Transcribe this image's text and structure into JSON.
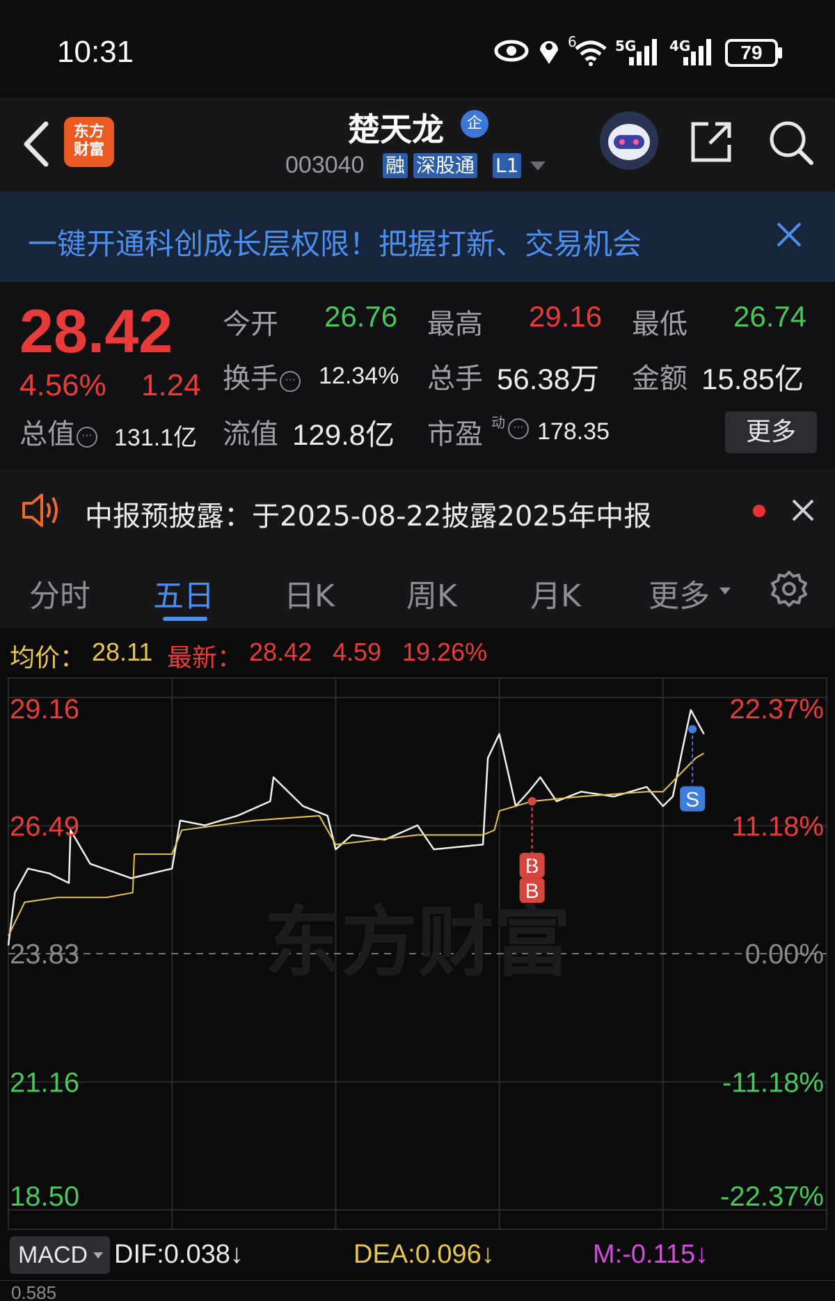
{
  "status_bar": {
    "time": "10:31",
    "battery": "79",
    "network_labels": [
      "6",
      "5G",
      "4G"
    ]
  },
  "header": {
    "app_logo_text": "东方财富",
    "stock_name": "楚天龙",
    "qi_badge": "企",
    "stock_code": "003040",
    "tags": [
      "融",
      "深股通",
      "L1"
    ]
  },
  "promo": {
    "text": "一键开通科创成长层权限！把握打新、交易机会"
  },
  "quote": {
    "last_price": "28.42",
    "change_pct": "4.56%",
    "change_amt": "1.24",
    "open_label": "今开",
    "open": "26.76",
    "high_label": "最高",
    "high": "29.16",
    "low_label": "最低",
    "low": "26.74",
    "turnover_label": "换手",
    "turnover": "12.34%",
    "volume_label": "总手",
    "volume": "56.38万",
    "amount_label": "金额",
    "amount": "15.85亿",
    "mktcap_label": "总值",
    "mktcap": "131.1亿",
    "float_label": "流值",
    "float_cap": "129.8亿",
    "pe_label": "市盈",
    "pe_sup": "动",
    "pe": "178.35",
    "more_button": "更多"
  },
  "notice": {
    "text": "中报预披露：于2025-08-22披露2025年中报"
  },
  "tabs": {
    "items": [
      "分时",
      "五日",
      "日K",
      "周K",
      "月K",
      "更多"
    ],
    "active": "五日"
  },
  "chart_info": {
    "avg_label": "均价：",
    "avg_value": "28.11",
    "latest_label": "最新：",
    "latest_value": "28.42",
    "latest_change": "4.59",
    "latest_amp": "19.26%"
  },
  "colors": {
    "up": "#ea3b3b",
    "down": "#48c85a",
    "accent": "#4a8ef2",
    "avg_line": "#e8c74a",
    "price_line": "#f2f2f2"
  },
  "chart_data": {
    "type": "line",
    "title": "",
    "days": 5,
    "ylim": [
      18.5,
      29.16
    ],
    "y_left_ticks": [
      "29.16",
      "26.49",
      "23.83",
      "21.16",
      "18.50"
    ],
    "y_right_ticks": [
      "22.37%",
      "11.18%",
      "0.00%",
      "-11.18%",
      "-22.37%"
    ],
    "prev_close": 23.83,
    "watermark": "东方财富",
    "series": [
      {
        "x": [
          0,
          0.04,
          0.12,
          0.25,
          0.37,
          0.38,
          0.5,
          0.75,
          1.0,
          1.05,
          1.2,
          1.4,
          1.6,
          1.62,
          1.8,
          1.95,
          2.0,
          2.1,
          2.3,
          2.5,
          2.6,
          2.9,
          2.93,
          3.0,
          3.1,
          3.18,
          3.25,
          3.35,
          3.5,
          3.7,
          3.9,
          4.0,
          4.06,
          4.12,
          4.17,
          4.25
        ],
        "values": [
          24.0,
          25.1,
          25.6,
          25.5,
          25.3,
          26.4,
          25.7,
          25.4,
          25.6,
          26.6,
          26.5,
          26.7,
          27.0,
          27.5,
          26.9,
          26.7,
          26.0,
          26.3,
          26.2,
          26.5,
          26.0,
          26.1,
          27.9,
          28.4,
          26.9,
          27.2,
          27.5,
          27.0,
          27.2,
          27.1,
          27.3,
          26.9,
          27.1,
          28.1,
          28.9,
          28.4
        ]
      },
      {
        "x": [
          0,
          0.1,
          0.3,
          0.6,
          0.76,
          0.77,
          1.0,
          1.06,
          1.5,
          1.9,
          2.0,
          2.5,
          2.9,
          2.97,
          3.0,
          3.1,
          3.2,
          3.5,
          3.9,
          4.0,
          4.2,
          4.25
        ],
        "values": [
          24.2,
          24.9,
          25.0,
          25.0,
          25.1,
          25.9,
          25.9,
          26.4,
          26.6,
          26.7,
          26.1,
          26.3,
          26.3,
          26.4,
          26.8,
          26.9,
          27.0,
          27.1,
          27.2,
          27.2,
          27.9,
          28.0
        ]
      }
    ],
    "markers": [
      {
        "label": "B",
        "day_x": 3.2,
        "price": 27.0
      },
      {
        "label": "B",
        "day_x": 3.2,
        "price": 27.0
      },
      {
        "label": "S",
        "day_x": 4.18,
        "price": 28.5
      }
    ]
  },
  "macd": {
    "select_label": "MACD",
    "dif": "DIF:0.038↓",
    "dea": "DEA:0.096↓",
    "m": "M:-0.115↓",
    "scale_top": "0.585"
  }
}
